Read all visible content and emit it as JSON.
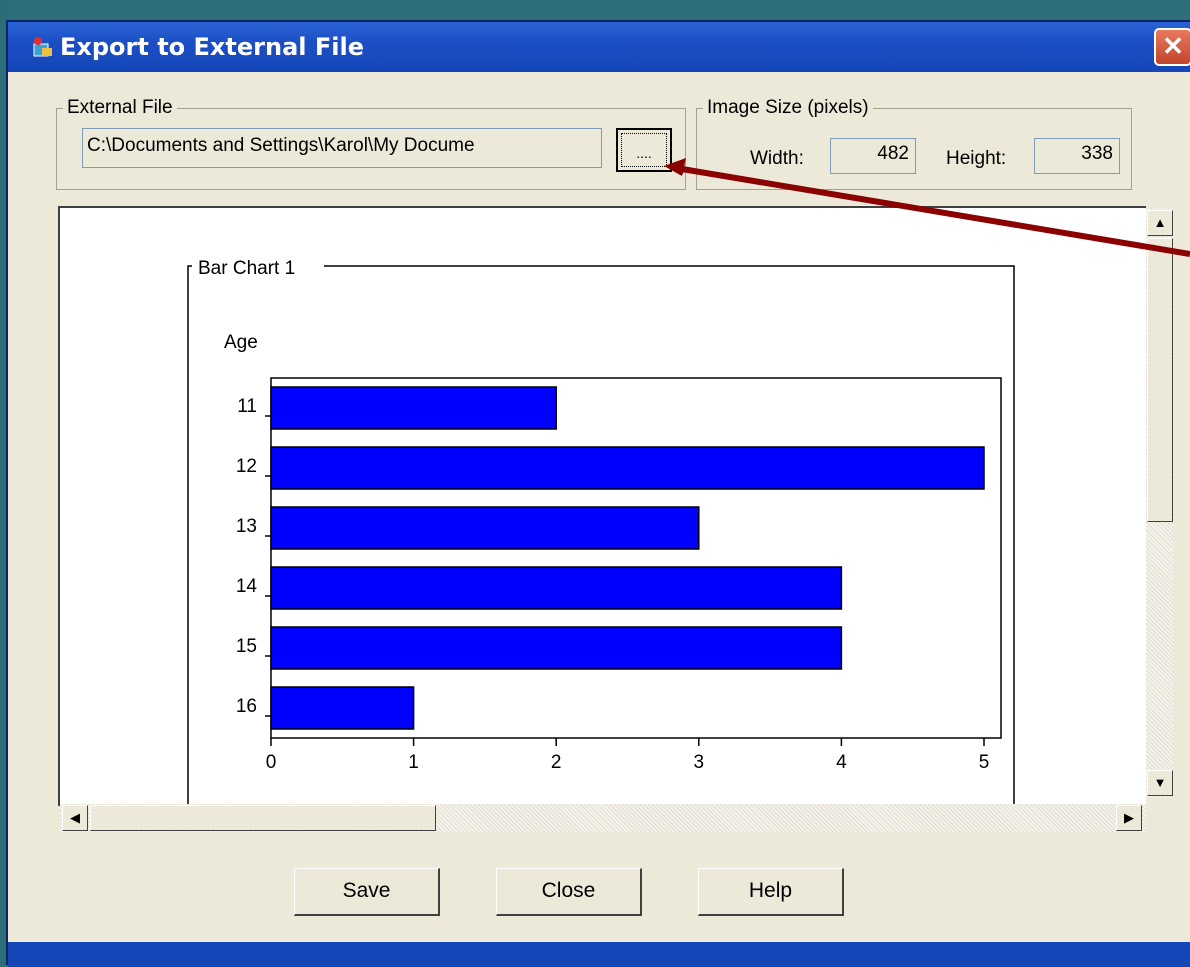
{
  "window": {
    "title": "Export to External File",
    "close_glyph": "✕"
  },
  "external_file": {
    "group_label": "External File",
    "path_value": "C:\\Documents and Settings\\Karol\\My Docume",
    "browse_label": "...."
  },
  "image_size": {
    "group_label": "Image Size (pixels)",
    "width_label": "Width:",
    "width_value": "482",
    "height_label": "Height:",
    "height_value": "338"
  },
  "chart_data": {
    "type": "bar",
    "orientation": "horizontal",
    "title": "Bar Chart 1",
    "ylabel": "Age",
    "categories": [
      "11",
      "12",
      "13",
      "14",
      "15",
      "16"
    ],
    "values": [
      2,
      5,
      3,
      4,
      4,
      1
    ],
    "xticks": [
      "0",
      "1",
      "2",
      "3",
      "4",
      "5"
    ],
    "xlim": [
      0,
      5
    ],
    "bar_color": "#0000ff"
  },
  "buttons": {
    "save": "Save",
    "close": "Close",
    "help": "Help"
  },
  "icons": {
    "scroll_up": "▲",
    "scroll_down": "▼",
    "scroll_left": "◀",
    "scroll_right": "▶"
  },
  "colors": {
    "titlebar": "#1c4fc4",
    "dialog_bg": "#ece9d8",
    "annotation_arrow": "#8b0000"
  }
}
